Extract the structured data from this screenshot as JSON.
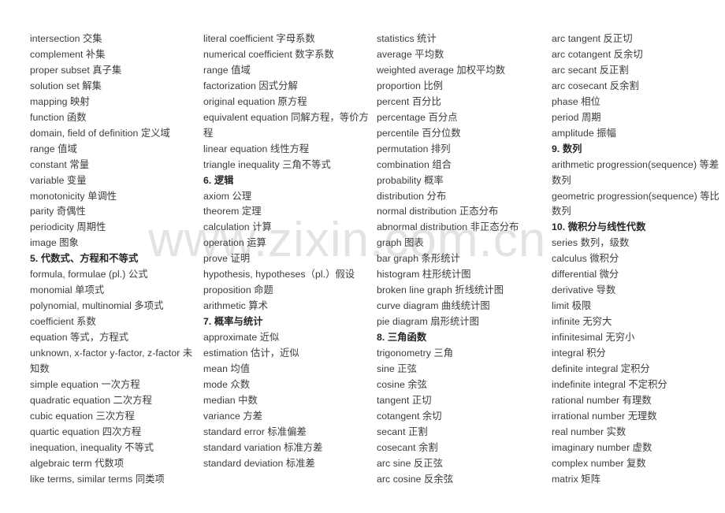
{
  "document": {
    "title": "数学英语词汇表",
    "watermark": "www.zixin.com.cn",
    "text_color": "#3b3b3b",
    "heading_color": "#262626",
    "watermark_color": "#e3e3e5",
    "background_color": "#ffffff"
  },
  "columns": [
    {
      "id": "column-1",
      "entries": [
        {
          "text": "intersection 交集",
          "heading": false
        },
        {
          "text": "complement 补集",
          "heading": false
        },
        {
          "text": "proper subset 真子集",
          "heading": false
        },
        {
          "text": "solution set 解集",
          "heading": false
        },
        {
          "text": "mapping 映射",
          "heading": false
        },
        {
          "text": "function 函数",
          "heading": false
        },
        {
          "text": "domain, field of definition 定义域",
          "heading": false
        },
        {
          "text": "range 值域",
          "heading": false
        },
        {
          "text": "constant 常量",
          "heading": false
        },
        {
          "text": "variable 变量",
          "heading": false
        },
        {
          "text": "monotonicity 单调性",
          "heading": false
        },
        {
          "text": "parity 奇偶性",
          "heading": false
        },
        {
          "text": "periodicity 周期性",
          "heading": false
        },
        {
          "text": "image 图象",
          "heading": false
        },
        {
          "text": "5. 代数式、方程和不等式",
          "heading": true
        },
        {
          "text": "formula, formulae (pl.) 公式",
          "heading": false
        },
        {
          "text": "monomial 单项式",
          "heading": false
        },
        {
          "text": "polynomial, multinomial 多项式",
          "heading": false
        },
        {
          "text": "coefficient 系数",
          "heading": false
        },
        {
          "text": "equation 等式，方程式",
          "heading": false
        },
        {
          "text": "unknown, x-factor y-factor, z-factor 未知数",
          "heading": false,
          "wrap": true
        },
        {
          "text": "simple equation 一次方程",
          "heading": false
        },
        {
          "text": "quadratic equation 二次方程",
          "heading": false
        },
        {
          "text": "cubic equation 三次方程",
          "heading": false
        },
        {
          "text": "quartic equation 四次方程",
          "heading": false
        },
        {
          "text": "inequation, inequality 不等式",
          "heading": false
        },
        {
          "text": "algebraic term 代数项",
          "heading": false
        },
        {
          "text": "like terms, similar terms 同类项",
          "heading": false
        }
      ]
    },
    {
      "id": "column-2",
      "entries": [
        {
          "text": "literal coefficient 字母系数",
          "heading": false
        },
        {
          "text": "numerical coefficient 数字系数",
          "heading": false
        },
        {
          "text": "range 值域",
          "heading": false
        },
        {
          "text": "factorization 因式分解",
          "heading": false
        },
        {
          "text": "original equation 原方程",
          "heading": false
        },
        {
          "text": "equivalent equation 同解方程，等价方程",
          "heading": false,
          "wrap": true
        },
        {
          "text": "linear equation 线性方程",
          "heading": false
        },
        {
          "text": "triangle inequality 三角不等式",
          "heading": false
        },
        {
          "text": "6. 逻辑",
          "heading": true
        },
        {
          "text": "axiom 公理",
          "heading": false
        },
        {
          "text": "theorem 定理",
          "heading": false
        },
        {
          "text": "calculation 计算",
          "heading": false
        },
        {
          "text": "operation 运算",
          "heading": false
        },
        {
          "text": "prove 证明",
          "heading": false
        },
        {
          "text": "hypothesis, hypotheses（pl.）假设",
          "heading": false,
          "wrap": true
        },
        {
          "text": "proposition 命题",
          "heading": false
        },
        {
          "text": "arithmetic 算术",
          "heading": false
        },
        {
          "text": "7. 概率与统计",
          "heading": true
        },
        {
          "text": "approximate 近似",
          "heading": false
        },
        {
          "text": "estimation 估计，近似",
          "heading": false
        },
        {
          "text": "mean 均值",
          "heading": false
        },
        {
          "text": "mode 众数",
          "heading": false
        },
        {
          "text": "median 中数",
          "heading": false
        },
        {
          "text": "variance 方差",
          "heading": false
        },
        {
          "text": "standard error 标准偏差",
          "heading": false
        },
        {
          "text": "standard variation 标准方差",
          "heading": false
        },
        {
          "text": "standard deviation 标准差",
          "heading": false
        }
      ]
    },
    {
      "id": "column-3",
      "entries": [
        {
          "text": "statistics 统计",
          "heading": false
        },
        {
          "text": "average 平均数",
          "heading": false
        },
        {
          "text": "weighted average 加权平均数",
          "heading": false
        },
        {
          "text": "proportion 比例",
          "heading": false
        },
        {
          "text": "percent 百分比",
          "heading": false
        },
        {
          "text": "percentage 百分点",
          "heading": false
        },
        {
          "text": "percentile 百分位数",
          "heading": false
        },
        {
          "text": "permutation 排列",
          "heading": false
        },
        {
          "text": "combination 组合",
          "heading": false
        },
        {
          "text": "probability 概率",
          "heading": false
        },
        {
          "text": "distribution 分布",
          "heading": false
        },
        {
          "text": "normal distribution 正态分布",
          "heading": false
        },
        {
          "text": "abnormal distribution 非正态分布",
          "heading": false
        },
        {
          "text": "graph 图表",
          "heading": false
        },
        {
          "text": "bar graph 条形统计",
          "heading": false
        },
        {
          "text": "histogram 柱形统计图",
          "heading": false
        },
        {
          "text": "broken line graph 折线统计图",
          "heading": false
        },
        {
          "text": "curve diagram 曲线统计图",
          "heading": false
        },
        {
          "text": "pie diagram 扇形统计图",
          "heading": false
        },
        {
          "text": "8. 三角函数",
          "heading": true
        },
        {
          "text": "trigonometry 三角",
          "heading": false
        },
        {
          "text": "sine 正弦",
          "heading": false
        },
        {
          "text": "cosine 余弦",
          "heading": false
        },
        {
          "text": "tangent 正切",
          "heading": false
        },
        {
          "text": "cotangent 余切",
          "heading": false
        },
        {
          "text": "secant 正割",
          "heading": false
        },
        {
          "text": "cosecant 余割",
          "heading": false
        },
        {
          "text": "arc sine 反正弦",
          "heading": false
        },
        {
          "text": "arc cosine 反余弦",
          "heading": false
        }
      ]
    },
    {
      "id": "column-4",
      "entries": [
        {
          "text": "arc tangent 反正切",
          "heading": false
        },
        {
          "text": "arc cotangent 反余切",
          "heading": false
        },
        {
          "text": "arc secant 反正割",
          "heading": false
        },
        {
          "text": "arc cosecant 反余割",
          "heading": false
        },
        {
          "text": "phase 相位",
          "heading": false
        },
        {
          "text": "period 周期",
          "heading": false
        },
        {
          "text": "amplitude 振幅",
          "heading": false
        },
        {
          "text": "9. 数列",
          "heading": true
        },
        {
          "text": "arithmetic progression(sequence) 等差数列",
          "heading": false,
          "wrap": true
        },
        {
          "text": "geometric progression(sequence) 等比数列",
          "heading": false,
          "wrap": true
        },
        {
          "text": "10. 微积分与线性代数",
          "heading": true
        },
        {
          "text": "series 数列，级数",
          "heading": false
        },
        {
          "text": "calculus 微积分",
          "heading": false
        },
        {
          "text": "differential 微分",
          "heading": false
        },
        {
          "text": "derivative 导数",
          "heading": false
        },
        {
          "text": "limit 极限",
          "heading": false
        },
        {
          "text": "infinite 无穷大",
          "heading": false
        },
        {
          "text": "infinitesimal 无穷小",
          "heading": false
        },
        {
          "text": "integral 积分",
          "heading": false
        },
        {
          "text": "definite integral 定积分",
          "heading": false
        },
        {
          "text": "indefinite integral 不定积分",
          "heading": false
        },
        {
          "text": "rational number 有理数",
          "heading": false
        },
        {
          "text": "irrational number 无理数",
          "heading": false
        },
        {
          "text": "real number 实数",
          "heading": false
        },
        {
          "text": "imaginary number 虚数",
          "heading": false
        },
        {
          "text": "complex number 复数",
          "heading": false
        },
        {
          "text": "matrix 矩阵",
          "heading": false
        }
      ]
    }
  ]
}
